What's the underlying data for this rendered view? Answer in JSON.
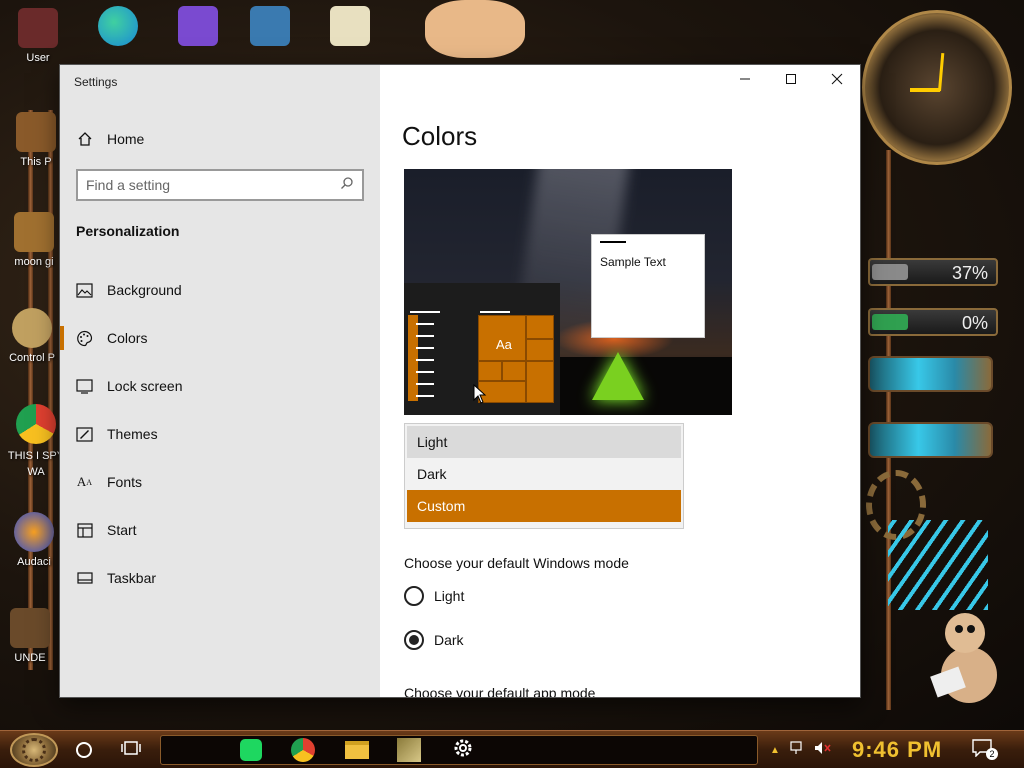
{
  "desktop": {
    "icons": [
      {
        "label": "User",
        "color": "#6a2a2a"
      },
      {
        "label": "This P",
        "color": "#8a5a2a"
      },
      {
        "label": "moon gi",
        "color": "#a07030"
      },
      {
        "label": "Control P",
        "color": "#c0a060"
      },
      {
        "label": "THIS I SPY WA",
        "color": "#e04030"
      },
      {
        "label": "Audaci",
        "color": "#2a4ad0"
      },
      {
        "label": "UNDE",
        "color": "#6a4a2a"
      }
    ],
    "top_icons": [
      {
        "label": "",
        "color": "#1a8ad8"
      },
      {
        "label": "",
        "color": "#7a4ad0"
      },
      {
        "label": "",
        "color": "#3a7ab0"
      },
      {
        "label": "",
        "color": "#e8e0c0"
      }
    ],
    "gadgets": {
      "cpu_meter": "37%",
      "ram_meter": "0%"
    }
  },
  "window": {
    "title": "Settings",
    "sidebar": {
      "home_label": "Home",
      "search_placeholder": "Find a setting",
      "section_title": "Personalization",
      "items": [
        {
          "label": "Background",
          "icon": "image-icon"
        },
        {
          "label": "Colors",
          "icon": "palette-icon"
        },
        {
          "label": "Lock screen",
          "icon": "lock-screen-icon"
        },
        {
          "label": "Themes",
          "icon": "themes-icon"
        },
        {
          "label": "Fonts",
          "icon": "fonts-icon"
        },
        {
          "label": "Start",
          "icon": "start-icon"
        },
        {
          "label": "Taskbar",
          "icon": "taskbar-icon"
        }
      ],
      "selected_index": 1
    },
    "content": {
      "page_title": "Colors",
      "preview": {
        "tile_text": "Aa",
        "sample_text": "Sample Text"
      },
      "color_options": [
        "Light",
        "Dark",
        "Custom"
      ],
      "color_selected": "Custom",
      "color_hover": "Light",
      "windows_mode_label": "Choose your default Windows mode",
      "windows_mode_options": [
        "Light",
        "Dark"
      ],
      "windows_mode_selected": "Dark",
      "app_mode_label": "Choose your default app mode"
    }
  },
  "taskbar": {
    "time": "9:46 PM",
    "notification_count": "2",
    "apps": [
      "spotify-icon",
      "chrome-icon",
      "file-explorer-icon",
      "image-app-icon",
      "settings-icon"
    ]
  },
  "colors": {
    "accent": "#c87000",
    "sidebar_bg": "#e6e6e6",
    "taskbar_time": "#f0c030"
  }
}
